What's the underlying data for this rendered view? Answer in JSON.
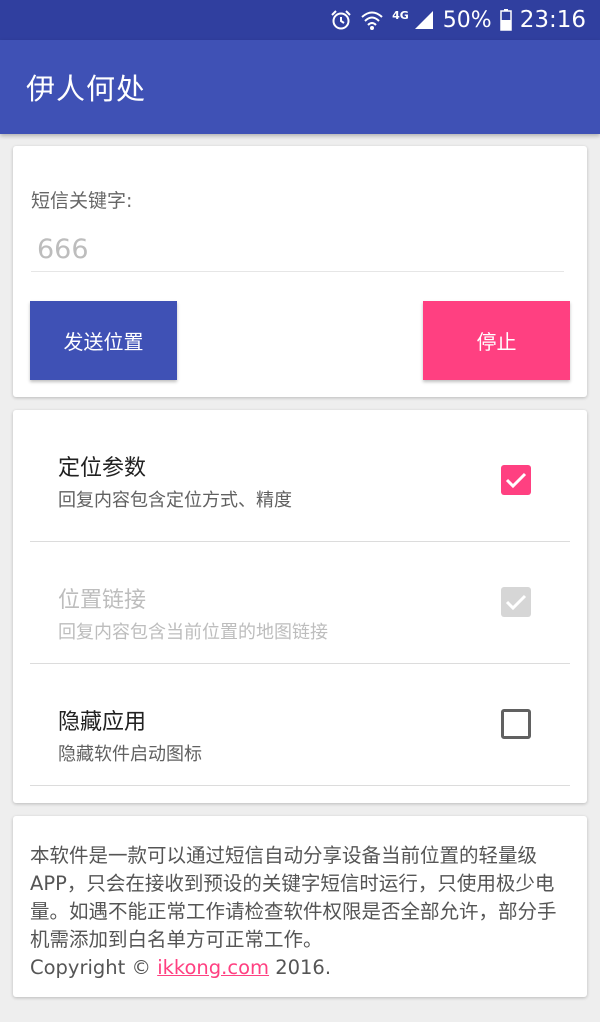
{
  "status_bar": {
    "network": "4G",
    "battery_percent": "50%",
    "time": "23:16",
    "icons": [
      "alarm-icon",
      "wifi-icon",
      "signal-icon",
      "battery-icon"
    ]
  },
  "app_bar": {
    "title": "伊人何处"
  },
  "keyword_card": {
    "label": "短信关键字:",
    "input_value": "",
    "input_placeholder": "666",
    "send_button": "发送位置",
    "stop_button": "停止"
  },
  "settings": [
    {
      "title": "定位参数",
      "summary": "回复内容包含定位方式、精度",
      "checked": true,
      "enabled": true
    },
    {
      "title": "位置链接",
      "summary": "回复内容包含当前位置的地图链接",
      "checked": true,
      "enabled": false
    },
    {
      "title": "隐藏应用",
      "summary": "隐藏软件启动图标",
      "checked": false,
      "enabled": true
    }
  ],
  "about": {
    "text": "本软件是一款可以通过短信自动分享设备当前位置的轻量级APP，只会在接收到预设的关键字短信时运行，只使用极少电量。如遇不能正常工作请检查软件权限是否全部允许，部分手机需添加到白名单方可正常工作。",
    "copyright_prefix": "Copyright © ",
    "link_text": "ikkong.com",
    "copyright_suffix": " 2016."
  },
  "colors": {
    "status_bar": "#303f9f",
    "primary": "#3f51b5",
    "accent": "#ff4081",
    "background": "#eeeeee"
  }
}
